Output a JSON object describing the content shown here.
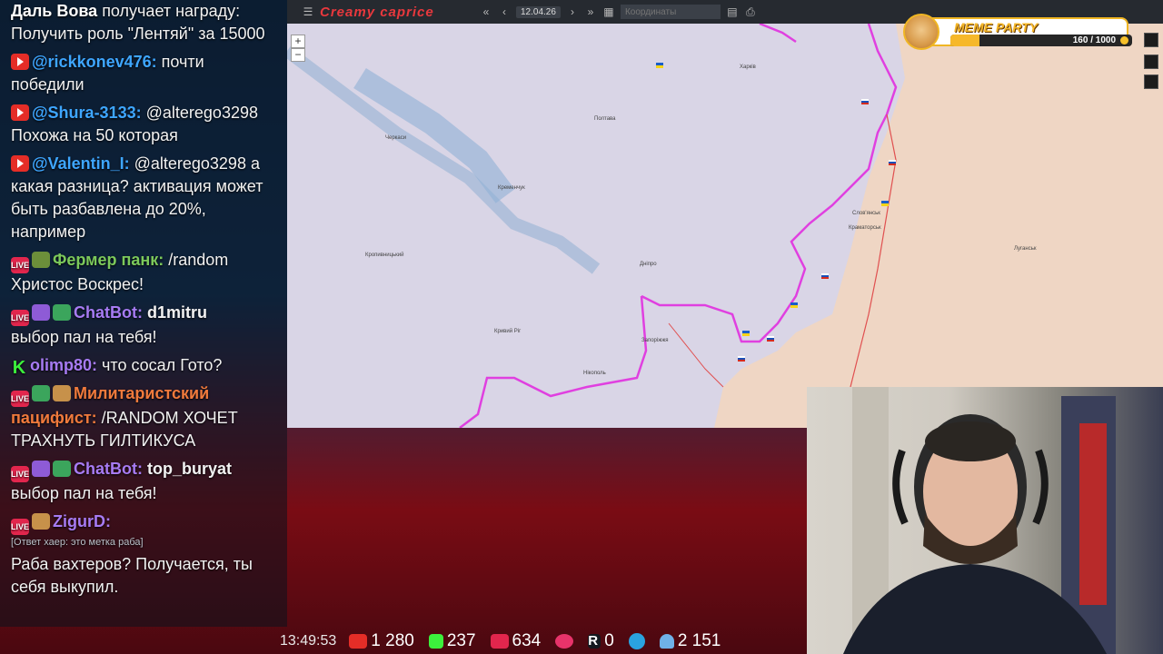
{
  "chat": {
    "messages": [
      {
        "badges": [],
        "nick": "Даль Вова",
        "nick_color": "#ffffff",
        "text": "получает награду: Получить роль \"Лентяй\" за 15000"
      },
      {
        "badges": [
          "yt"
        ],
        "nick": "@rickkonev476:",
        "nick_color": "#3ea6ff",
        "text": "почти победили"
      },
      {
        "badges": [
          "yt"
        ],
        "nick": "@Shura-3133:",
        "nick_color": "#3ea6ff",
        "text": "@alterego3298 Похожа на 50 которая"
      },
      {
        "badges": [
          "yt"
        ],
        "nick": "@Valentin_I:",
        "nick_color": "#3ea6ff",
        "text": "@alterego3298 а какая разница? активация может быть разбавлена до 20%, например"
      },
      {
        "badges": [
          "live",
          "emo2"
        ],
        "nick": "Фермер панк:",
        "nick_color": "#7cc95b",
        "text": "/random Христос Воскрес!"
      },
      {
        "badges": [
          "live",
          "emo",
          "emo4"
        ],
        "nick": "ChatBot:",
        "nick_color": "#a77bf3",
        "text": "d1mitru",
        "text_bold": true,
        "text2": "выбор пал на тебя!"
      },
      {
        "badges": [
          "kick"
        ],
        "nick": "olimp80:",
        "nick_color": "#a77bf3",
        "text": "что сосал Гото?"
      },
      {
        "badges": [
          "live",
          "emo4",
          "emo3"
        ],
        "nick": "Милитаристский пацифист:",
        "nick_color": "#f07a3c",
        "text": "/RANDOM ХОЧЕТ ТРАХНУТЬ ГИЛТИКУСА"
      },
      {
        "badges": [
          "live",
          "emo",
          "emo4"
        ],
        "nick": "ChatBot:",
        "nick_color": "#a77bf3",
        "text": "top_buryat",
        "text_bold": true,
        "text2": "выбор пал на тебя!"
      },
      {
        "badges": [
          "live",
          "emo3"
        ],
        "nick": "ZigurD:",
        "nick_color": "#a77bf3",
        "reply": "[Ответ хаер: это метка раба]",
        "text": "Раба вахтеров? Получается, ты себя выкупил."
      }
    ]
  },
  "toolbar": {
    "brand": "Creamy caprice",
    "date": "12.04.26",
    "coords_placeholder": "Координаты"
  },
  "map": {
    "zoom_in": "+",
    "zoom_out": "−",
    "cities": [
      {
        "name": "Черкаси"
      },
      {
        "name": "Полтава"
      },
      {
        "name": "Харків"
      },
      {
        "name": "Кременчук"
      },
      {
        "name": "Дніпро"
      },
      {
        "name": "Кривий Ріг"
      },
      {
        "name": "Запоріжжя"
      },
      {
        "name": "Краматорськ"
      },
      {
        "name": "Слов'янськ"
      },
      {
        "name": "Луганськ"
      },
      {
        "name": "Кропивницький"
      },
      {
        "name": "Нікополь"
      }
    ]
  },
  "meme_party": {
    "title": "MEME PARTY",
    "count": "160 / 1000",
    "progress": 0.16
  },
  "stats": {
    "time": "13:49:53",
    "youtube": "1 280",
    "kick": "237",
    "live": "634",
    "rutube": "0",
    "telegram": "",
    "viewers": "2 151"
  },
  "colors": {
    "accent_red": "#e8383d",
    "front_line": "#e040e0",
    "occupied": "#f1d6c0",
    "controlled": "#d9d5e6"
  }
}
